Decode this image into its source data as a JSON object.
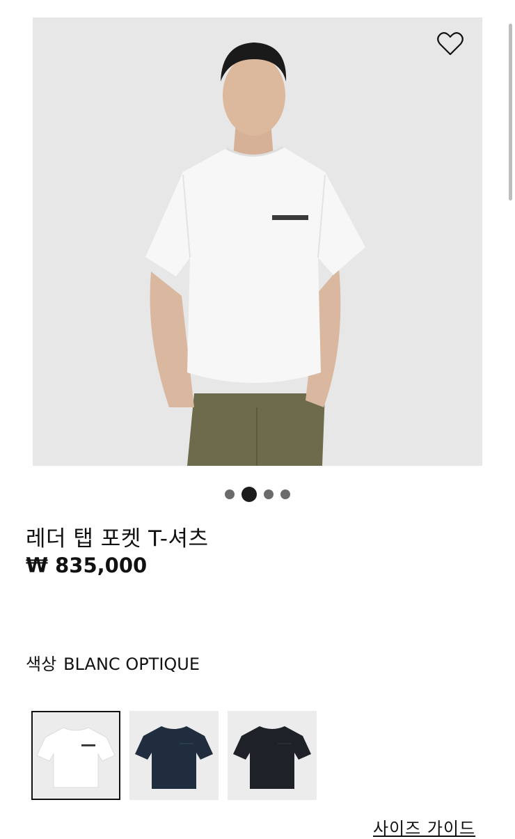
{
  "product": {
    "title": "레더 탭 포켓 T-셔츠",
    "currency_symbol": "₩",
    "price": "835,000"
  },
  "gallery": {
    "image_count": 4,
    "active_index": 1,
    "wishlist_icon": "heart-outline-icon"
  },
  "color": {
    "label": "색상",
    "selected_value": "BLANC OPTIQUE",
    "swatches": [
      {
        "hex": "#ffffff"
      },
      {
        "hex": "#1f2d3e"
      },
      {
        "hex": "#1e2127"
      }
    ]
  },
  "size_guide": {
    "label": "사이즈 가이드"
  }
}
